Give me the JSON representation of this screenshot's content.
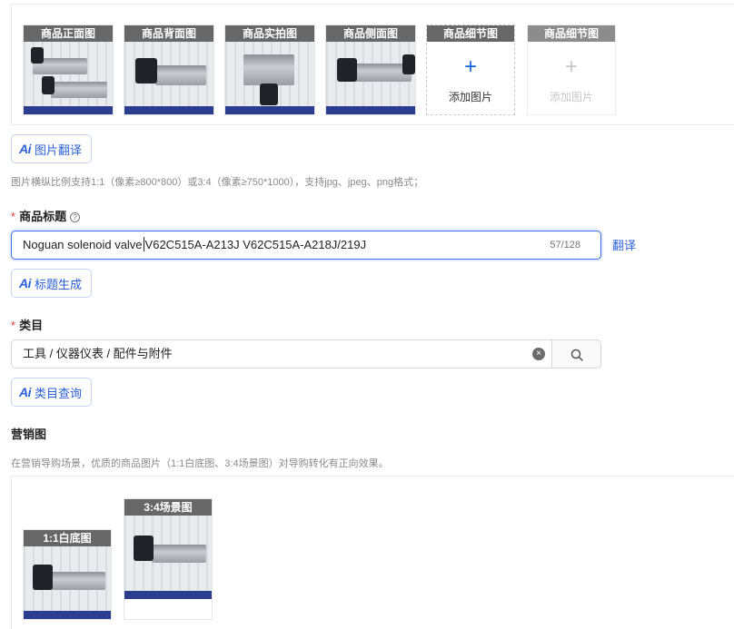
{
  "main_images": {
    "slots": [
      {
        "caption": "商品正面图"
      },
      {
        "caption": "商品背面图"
      },
      {
        "caption": "商品实拍图"
      },
      {
        "caption": "商品侧面图"
      }
    ],
    "add_slots": [
      {
        "caption": "商品细节图",
        "plus": "+",
        "label": "添加图片"
      },
      {
        "caption": "商品细节图",
        "plus": "+",
        "label": "添加图片"
      }
    ]
  },
  "image_translate_button": {
    "ai": "Ai",
    "label": "图片翻译"
  },
  "image_hint": "图片横纵比例支持1:1（像素≥800*800）或3:4（像素≥750*1000），支持jpg、jpeg、png格式；",
  "title_field": {
    "required_mark": "*",
    "label": "商品标题",
    "help": "?",
    "value_before_caret": "Noguan solenoid valve",
    "value_after_caret": "V62C515A-A213J V62C515A-A218J/219J",
    "counter": "57/128",
    "translate_link": "翻译"
  },
  "title_generate_button": {
    "ai": "Ai",
    "label": "标题生成"
  },
  "category_field": {
    "required_mark": "*",
    "label": "类目",
    "value": "工具 / 仪器仪表 / 配件与附件",
    "clear": "×"
  },
  "category_query_button": {
    "ai": "Ai",
    "label": "类目查询"
  },
  "marketing": {
    "label": "营销图",
    "hint": "在营销导购场景，优质的商品图片（1:1白底图、3:4场景图）对导购转化有正向效果。",
    "images": [
      {
        "caption": "1:1白底图"
      },
      {
        "caption": "3:4场景图"
      }
    ]
  },
  "colors": {
    "accent": "#2a5fd6",
    "required": "#e23b3b",
    "caption_bg": "#5a5a5a"
  }
}
